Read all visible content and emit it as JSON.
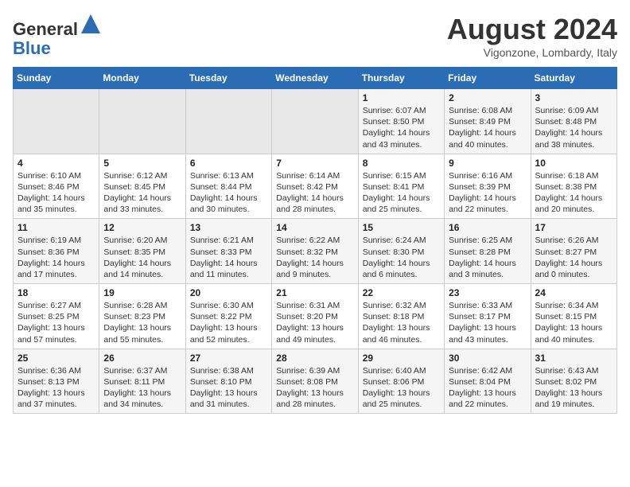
{
  "header": {
    "logo_line1": "General",
    "logo_line2": "Blue",
    "month_title": "August 2024",
    "subtitle": "Vigonzone, Lombardy, Italy"
  },
  "weekdays": [
    "Sunday",
    "Monday",
    "Tuesday",
    "Wednesday",
    "Thursday",
    "Friday",
    "Saturday"
  ],
  "weeks": [
    [
      {
        "day": "",
        "sunrise": "",
        "sunset": "",
        "daylight": ""
      },
      {
        "day": "",
        "sunrise": "",
        "sunset": "",
        "daylight": ""
      },
      {
        "day": "",
        "sunrise": "",
        "sunset": "",
        "daylight": ""
      },
      {
        "day": "",
        "sunrise": "",
        "sunset": "",
        "daylight": ""
      },
      {
        "day": "1",
        "sunrise": "Sunrise: 6:07 AM",
        "sunset": "Sunset: 8:50 PM",
        "daylight": "Daylight: 14 hours and 43 minutes."
      },
      {
        "day": "2",
        "sunrise": "Sunrise: 6:08 AM",
        "sunset": "Sunset: 8:49 PM",
        "daylight": "Daylight: 14 hours and 40 minutes."
      },
      {
        "day": "3",
        "sunrise": "Sunrise: 6:09 AM",
        "sunset": "Sunset: 8:48 PM",
        "daylight": "Daylight: 14 hours and 38 minutes."
      }
    ],
    [
      {
        "day": "4",
        "sunrise": "Sunrise: 6:10 AM",
        "sunset": "Sunset: 8:46 PM",
        "daylight": "Daylight: 14 hours and 35 minutes."
      },
      {
        "day": "5",
        "sunrise": "Sunrise: 6:12 AM",
        "sunset": "Sunset: 8:45 PM",
        "daylight": "Daylight: 14 hours and 33 minutes."
      },
      {
        "day": "6",
        "sunrise": "Sunrise: 6:13 AM",
        "sunset": "Sunset: 8:44 PM",
        "daylight": "Daylight: 14 hours and 30 minutes."
      },
      {
        "day": "7",
        "sunrise": "Sunrise: 6:14 AM",
        "sunset": "Sunset: 8:42 PM",
        "daylight": "Daylight: 14 hours and 28 minutes."
      },
      {
        "day": "8",
        "sunrise": "Sunrise: 6:15 AM",
        "sunset": "Sunset: 8:41 PM",
        "daylight": "Daylight: 14 hours and 25 minutes."
      },
      {
        "day": "9",
        "sunrise": "Sunrise: 6:16 AM",
        "sunset": "Sunset: 8:39 PM",
        "daylight": "Daylight: 14 hours and 22 minutes."
      },
      {
        "day": "10",
        "sunrise": "Sunrise: 6:18 AM",
        "sunset": "Sunset: 8:38 PM",
        "daylight": "Daylight: 14 hours and 20 minutes."
      }
    ],
    [
      {
        "day": "11",
        "sunrise": "Sunrise: 6:19 AM",
        "sunset": "Sunset: 8:36 PM",
        "daylight": "Daylight: 14 hours and 17 minutes."
      },
      {
        "day": "12",
        "sunrise": "Sunrise: 6:20 AM",
        "sunset": "Sunset: 8:35 PM",
        "daylight": "Daylight: 14 hours and 14 minutes."
      },
      {
        "day": "13",
        "sunrise": "Sunrise: 6:21 AM",
        "sunset": "Sunset: 8:33 PM",
        "daylight": "Daylight: 14 hours and 11 minutes."
      },
      {
        "day": "14",
        "sunrise": "Sunrise: 6:22 AM",
        "sunset": "Sunset: 8:32 PM",
        "daylight": "Daylight: 14 hours and 9 minutes."
      },
      {
        "day": "15",
        "sunrise": "Sunrise: 6:24 AM",
        "sunset": "Sunset: 8:30 PM",
        "daylight": "Daylight: 14 hours and 6 minutes."
      },
      {
        "day": "16",
        "sunrise": "Sunrise: 6:25 AM",
        "sunset": "Sunset: 8:28 PM",
        "daylight": "Daylight: 14 hours and 3 minutes."
      },
      {
        "day": "17",
        "sunrise": "Sunrise: 6:26 AM",
        "sunset": "Sunset: 8:27 PM",
        "daylight": "Daylight: 14 hours and 0 minutes."
      }
    ],
    [
      {
        "day": "18",
        "sunrise": "Sunrise: 6:27 AM",
        "sunset": "Sunset: 8:25 PM",
        "daylight": "Daylight: 13 hours and 57 minutes."
      },
      {
        "day": "19",
        "sunrise": "Sunrise: 6:28 AM",
        "sunset": "Sunset: 8:23 PM",
        "daylight": "Daylight: 13 hours and 55 minutes."
      },
      {
        "day": "20",
        "sunrise": "Sunrise: 6:30 AM",
        "sunset": "Sunset: 8:22 PM",
        "daylight": "Daylight: 13 hours and 52 minutes."
      },
      {
        "day": "21",
        "sunrise": "Sunrise: 6:31 AM",
        "sunset": "Sunset: 8:20 PM",
        "daylight": "Daylight: 13 hours and 49 minutes."
      },
      {
        "day": "22",
        "sunrise": "Sunrise: 6:32 AM",
        "sunset": "Sunset: 8:18 PM",
        "daylight": "Daylight: 13 hours and 46 minutes."
      },
      {
        "day": "23",
        "sunrise": "Sunrise: 6:33 AM",
        "sunset": "Sunset: 8:17 PM",
        "daylight": "Daylight: 13 hours and 43 minutes."
      },
      {
        "day": "24",
        "sunrise": "Sunrise: 6:34 AM",
        "sunset": "Sunset: 8:15 PM",
        "daylight": "Daylight: 13 hours and 40 minutes."
      }
    ],
    [
      {
        "day": "25",
        "sunrise": "Sunrise: 6:36 AM",
        "sunset": "Sunset: 8:13 PM",
        "daylight": "Daylight: 13 hours and 37 minutes."
      },
      {
        "day": "26",
        "sunrise": "Sunrise: 6:37 AM",
        "sunset": "Sunset: 8:11 PM",
        "daylight": "Daylight: 13 hours and 34 minutes."
      },
      {
        "day": "27",
        "sunrise": "Sunrise: 6:38 AM",
        "sunset": "Sunset: 8:10 PM",
        "daylight": "Daylight: 13 hours and 31 minutes."
      },
      {
        "day": "28",
        "sunrise": "Sunrise: 6:39 AM",
        "sunset": "Sunset: 8:08 PM",
        "daylight": "Daylight: 13 hours and 28 minutes."
      },
      {
        "day": "29",
        "sunrise": "Sunrise: 6:40 AM",
        "sunset": "Sunset: 8:06 PM",
        "daylight": "Daylight: 13 hours and 25 minutes."
      },
      {
        "day": "30",
        "sunrise": "Sunrise: 6:42 AM",
        "sunset": "Sunset: 8:04 PM",
        "daylight": "Daylight: 13 hours and 22 minutes."
      },
      {
        "day": "31",
        "sunrise": "Sunrise: 6:43 AM",
        "sunset": "Sunset: 8:02 PM",
        "daylight": "Daylight: 13 hours and 19 minutes."
      }
    ]
  ]
}
